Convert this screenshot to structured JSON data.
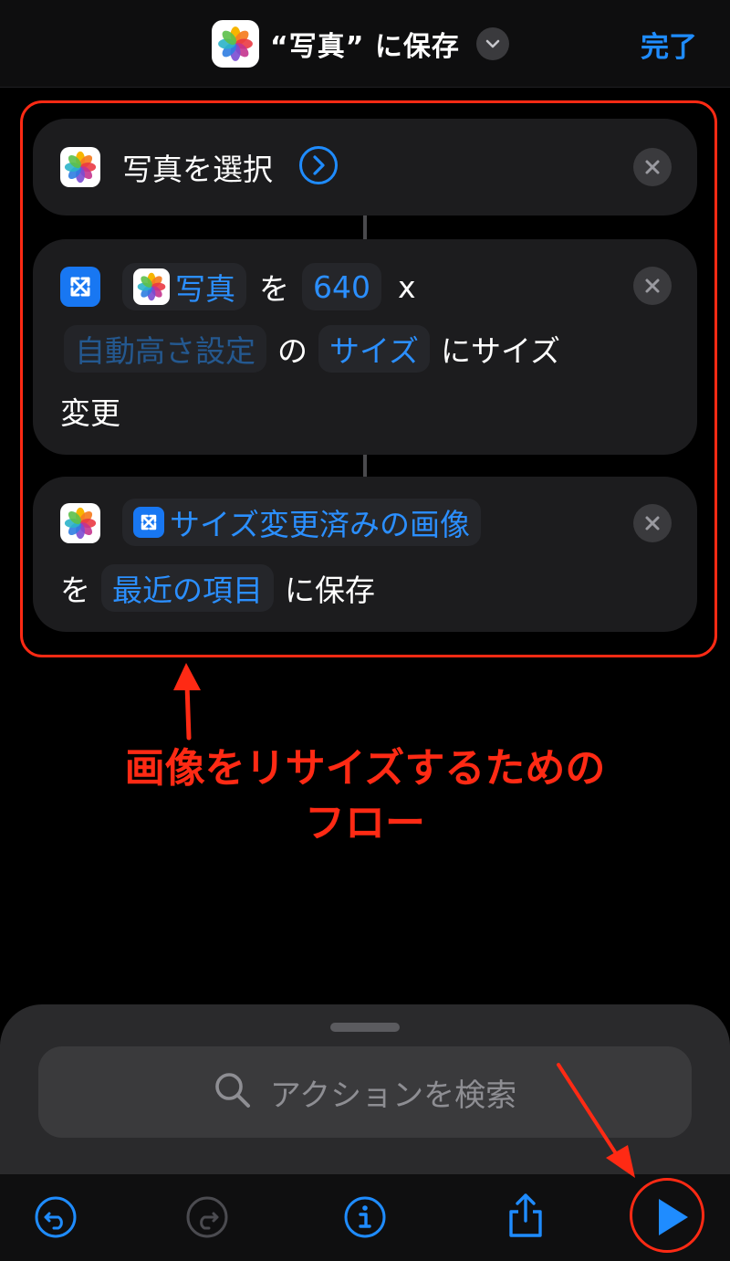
{
  "header": {
    "title": "“写真” に保存",
    "done_label": "完了"
  },
  "actions": {
    "select": {
      "label": "写真を選択"
    },
    "resize": {
      "input_chip": "写真",
      "word_wo": "を",
      "width_value": "640",
      "times": "x",
      "height_chip": "自動高さ設定",
      "word_no": "の",
      "size_chip": "サイズ",
      "suffix": "にサイズ",
      "suffix2": "変更"
    },
    "save": {
      "input_chip": "サイズ変更済みの画像",
      "word_wo": "を",
      "album_chip": "最近の項目",
      "suffix": "に保存"
    }
  },
  "annotation": {
    "line1": "画像をリサイズするための",
    "line2": "フロー"
  },
  "search": {
    "placeholder": "アクションを検索"
  },
  "icons": {
    "app": "photos-icon",
    "resize": "resize-image-icon",
    "close": "close-icon",
    "chevron": "chevron-right-icon",
    "search": "search-icon",
    "toolbar": [
      "undo-icon",
      "redo-icon",
      "info-icon",
      "share-icon",
      "play-icon"
    ]
  },
  "colors": {
    "accent": "#1f8cff",
    "annotation": "#ff2a14",
    "card": "#1c1c1e"
  }
}
